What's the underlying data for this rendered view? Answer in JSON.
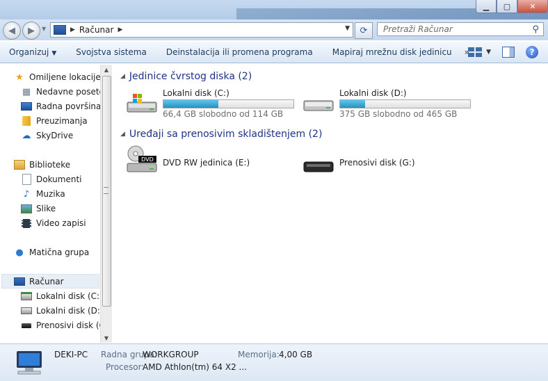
{
  "window": {
    "min_symbol": "▁",
    "max_symbol": "▢",
    "close_symbol": "✕"
  },
  "address_bar": {
    "breadcrumb": "Računar",
    "search_placeholder": "Pretraži Računar"
  },
  "toolbar": {
    "organize": "Organizuj",
    "system_properties": "Svojstva sistema",
    "uninstall": "Deinstalacija ili promena programa",
    "map_drive": "Mapiraj mrežnu disk jedinicu",
    "more": "»"
  },
  "sidebar": {
    "favorites": "Omiljene lokacije",
    "recent": "Nedavne posete",
    "desktop": "Radna površina",
    "downloads": "Preuzimanja",
    "skydrive": "SkyDrive",
    "libraries": "Biblioteke",
    "documents": "Dokumenti",
    "music": "Muzika",
    "pictures": "Slike",
    "videos": "Video zapisi",
    "homegroup": "Matična grupa",
    "computer": "Računar",
    "drive_c": "Lokalni disk (C:)",
    "drive_d": "Lokalni disk (D:)",
    "drive_g": "Prenosivi disk (G:"
  },
  "groups": {
    "hard_drives": "Jedinice čvrstog diska (2)",
    "removable": "Uređaji sa prenosivim skladištenjem (2)"
  },
  "drives": {
    "c": {
      "name": "Lokalni disk (C:)",
      "free_text": "66,4 GB slobodno od 114 GB",
      "used_fraction": 0.42
    },
    "d": {
      "name": "Lokalni disk (D:)",
      "free_text": "375 GB slobodno od 465 GB",
      "used_fraction": 0.19
    },
    "e": {
      "name": "DVD RW jedinica (E:)",
      "badge": "DVD"
    },
    "g": {
      "name": "Prenosivi disk (G:)"
    }
  },
  "details": {
    "computer_name": "DEKI-PC",
    "workgroup_label": "Radna grupa:",
    "workgroup_value": "WORKGROUP",
    "memory_label": "Memorija:",
    "memory_value": "4,00 GB",
    "processor_label": "Procesor:",
    "processor_value": "AMD Athlon(tm) 64 X2 ..."
  },
  "colors": {
    "accent": "#1e3287",
    "bar_fill": "#2790bd"
  }
}
